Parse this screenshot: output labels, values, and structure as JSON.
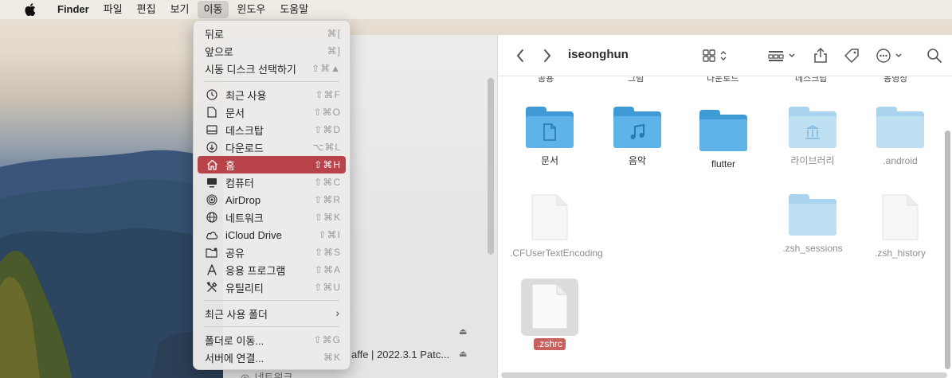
{
  "menubar": {
    "app": "Finder",
    "items": [
      "파일",
      "편집",
      "보기",
      "이동",
      "윈도우",
      "도움말"
    ]
  },
  "go_menu": {
    "back": {
      "label": "뒤로",
      "shortcut": "⌘["
    },
    "forward": {
      "label": "앞으로",
      "shortcut": "⌘]"
    },
    "startup_disk": {
      "label": "시동 디스크 선택하기",
      "shortcut": "⇧⌘▲"
    },
    "places": [
      {
        "label": "최근 사용",
        "shortcut": "⇧⌘F",
        "icon": "clock-icon"
      },
      {
        "label": "문서",
        "shortcut": "⇧⌘O",
        "icon": "document-icon"
      },
      {
        "label": "데스크탑",
        "shortcut": "⇧⌘D",
        "icon": "desktop-icon"
      },
      {
        "label": "다운로드",
        "shortcut": "⌥⌘L",
        "icon": "download-icon"
      },
      {
        "label": "홈",
        "shortcut": "⇧⌘H",
        "icon": "home-icon"
      },
      {
        "label": "컴퓨터",
        "shortcut": "⇧⌘C",
        "icon": "computer-icon"
      },
      {
        "label": "AirDrop",
        "shortcut": "⇧⌘R",
        "icon": "airdrop-icon"
      },
      {
        "label": "네트워크",
        "shortcut": "⇧⌘K",
        "icon": "network-icon"
      },
      {
        "label": "iCloud Drive",
        "shortcut": "⇧⌘I",
        "icon": "cloud-icon"
      },
      {
        "label": "공유",
        "shortcut": "⇧⌘S",
        "icon": "shared-folder-icon"
      },
      {
        "label": "응용 프로그램",
        "shortcut": "⇧⌘A",
        "icon": "applications-icon"
      },
      {
        "label": "유틸리티",
        "shortcut": "⇧⌘U",
        "icon": "utilities-icon"
      }
    ],
    "recent_folders": {
      "label": "최근 사용 폴더"
    },
    "go_to_folder": {
      "label": "폴더로 이동...",
      "shortcut": "⇧⌘G"
    },
    "connect_server": {
      "label": "서버에 연결...",
      "shortcut": "⌘K"
    }
  },
  "sidebar": {
    "device_label": "affe | 2022.3.1 Patc...",
    "network_label": "네트워크"
  },
  "finder": {
    "title": "iseonghun",
    "partial_row": [
      "공용",
      "그림",
      "다운로드",
      "데스크탑",
      "동영상"
    ],
    "items": [
      {
        "label": "문서",
        "kind": "folder",
        "glyph": "doc"
      },
      {
        "label": "음악",
        "kind": "folder",
        "glyph": "music"
      },
      {
        "label": "flutter",
        "kind": "folder",
        "glyph": ""
      },
      {
        "label": "라이브러리",
        "kind": "folder",
        "glyph": "library"
      },
      {
        "label": ".android",
        "kind": "folder",
        "glyph": ""
      },
      {
        "label": ".CFUserTextEncoding",
        "kind": "file"
      },
      {
        "label": ".zsh_sessions",
        "kind": "folder",
        "glyph": ""
      },
      {
        "label": ".zsh_history",
        "kind": "file"
      },
      {
        "label": ".zshrc",
        "kind": "file"
      }
    ]
  },
  "colors": {
    "folder_blue": "#5eb3e8",
    "folder_blue_dim": "#bfe0f3",
    "menu_highlight": "#b8434b"
  }
}
